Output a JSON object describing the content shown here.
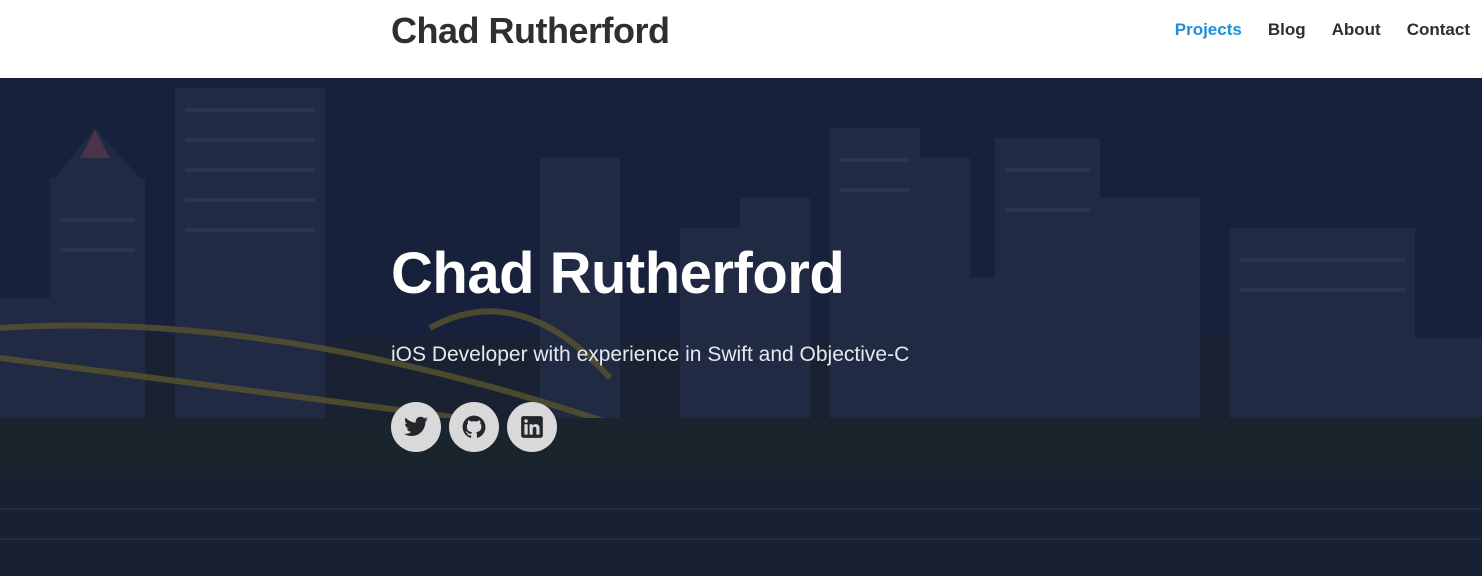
{
  "header": {
    "brand": "Chad Rutherford",
    "nav": [
      {
        "label": "Projects",
        "active": true
      },
      {
        "label": "Blog",
        "active": false
      },
      {
        "label": "About",
        "active": false
      },
      {
        "label": "Contact",
        "active": false
      }
    ]
  },
  "hero": {
    "title": "Chad Rutherford",
    "subtitle": "iOS Developer with experience in Swift and Objective-C",
    "background": "city-skyline-night-photo",
    "social": [
      {
        "icon": "twitter-icon"
      },
      {
        "icon": "github-icon"
      },
      {
        "icon": "linkedin-icon"
      }
    ]
  },
  "colors": {
    "accent": "#1c8fd9",
    "text_dark": "#2d2f33",
    "social_bg": "#d9d9d9"
  }
}
